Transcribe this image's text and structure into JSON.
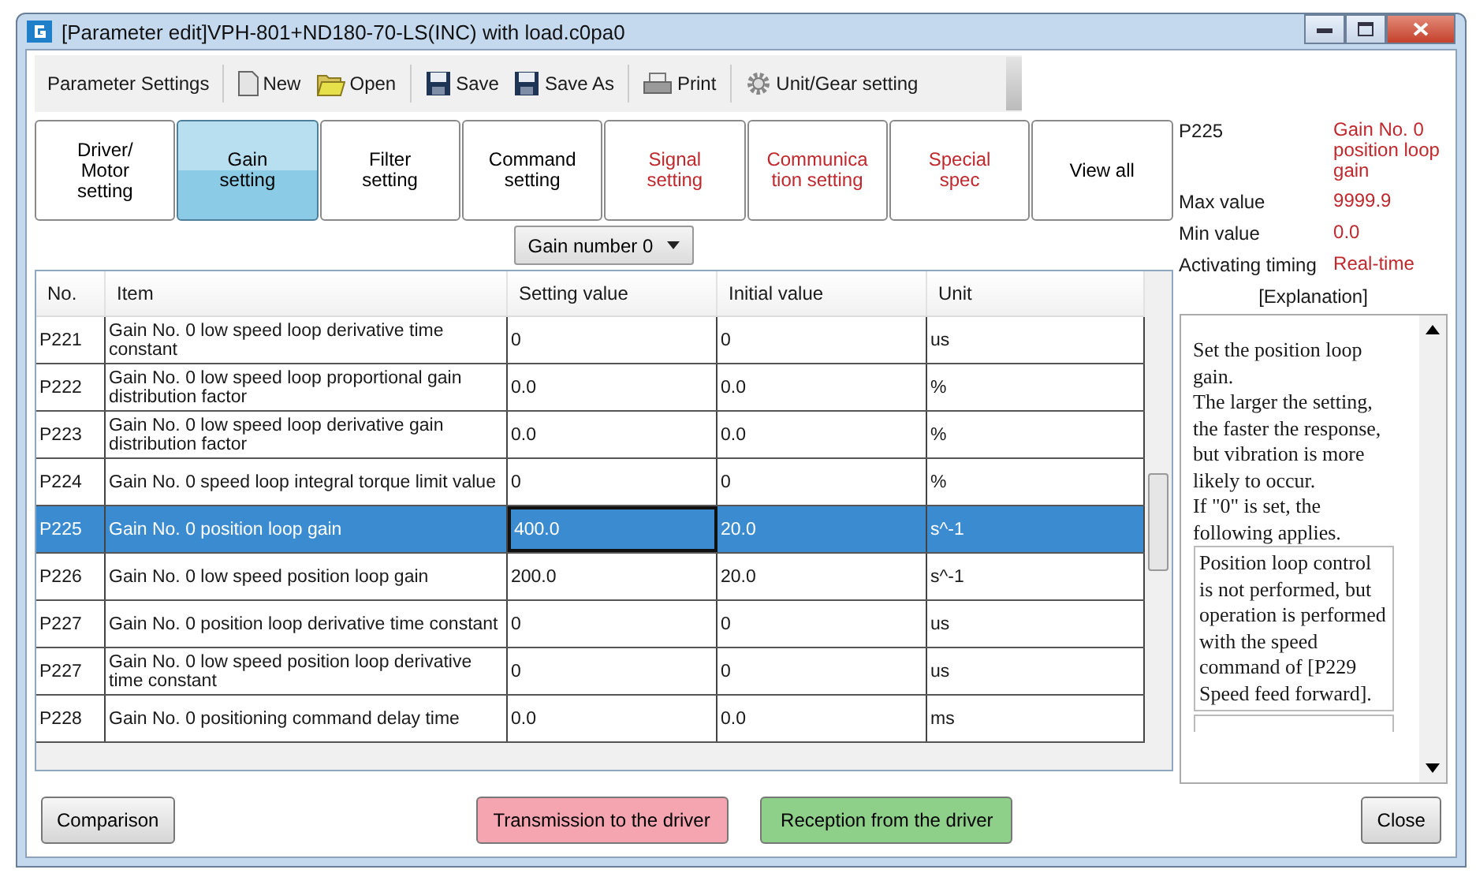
{
  "window": {
    "title": "[Parameter edit]VPH-801+ND180-70-LS(INC) with load.c0pa0"
  },
  "toolbar": {
    "label": "Parameter Settings",
    "items": [
      {
        "kind": "new",
        "label": "New"
      },
      {
        "kind": "open",
        "label": "Open"
      },
      {
        "kind": "save",
        "label": "Save"
      },
      {
        "kind": "save",
        "label": "Save As"
      },
      {
        "kind": "print",
        "label": "Print"
      },
      {
        "kind": "gear",
        "label": "Unit/Gear setting"
      }
    ]
  },
  "tabs": [
    {
      "label": "Driver/\nMotor\nsetting",
      "selected": false,
      "modified": false
    },
    {
      "label": "Gain\nsetting",
      "selected": true,
      "modified": false
    },
    {
      "label": "Filter\nsetting",
      "selected": false,
      "modified": false
    },
    {
      "label": "Command\nsetting",
      "selected": false,
      "modified": false
    },
    {
      "label": "Signal\nsetting",
      "selected": false,
      "modified": true
    },
    {
      "label": "Communica\ntion setting",
      "selected": false,
      "modified": true
    },
    {
      "label": "Special\nspec",
      "selected": false,
      "modified": true
    },
    {
      "label": "View all",
      "selected": false,
      "modified": false
    }
  ],
  "gain_dropdown": {
    "value": "Gain number 0"
  },
  "table": {
    "columns": [
      "No.",
      "Item",
      "Setting value",
      "Initial value",
      "Unit"
    ],
    "rows": [
      {
        "no": "P221",
        "item": "Gain No. 0 low speed loop derivative time constant",
        "setting": "0",
        "initial": "0",
        "unit": "us",
        "selected": false
      },
      {
        "no": "P222",
        "item": "Gain No. 0 low speed loop proportional gain distribution factor",
        "setting": "0.0",
        "initial": "0.0",
        "unit": "%",
        "selected": false
      },
      {
        "no": "P223",
        "item": "Gain No. 0 low speed loop derivative gain distribution factor",
        "setting": "0.0",
        "initial": "0.0",
        "unit": "%",
        "selected": false
      },
      {
        "no": "P224",
        "item": "Gain No. 0 speed loop integral torque limit value",
        "setting": "0",
        "initial": "0",
        "unit": "%",
        "selected": false
      },
      {
        "no": "P225",
        "item": "Gain No. 0 position loop gain",
        "setting": "400.0",
        "initial": "20.0",
        "unit": "s^-1",
        "selected": true
      },
      {
        "no": "P226",
        "item": "Gain No. 0 low speed position loop gain",
        "setting": "200.0",
        "initial": "20.0",
        "unit": "s^-1",
        "selected": false
      },
      {
        "no": "P227",
        "item": "Gain No. 0 position loop derivative time constant",
        "setting": "0",
        "initial": "0",
        "unit": "us",
        "selected": false
      },
      {
        "no": "P227",
        "item": "Gain No. 0 low speed position loop derivative time constant",
        "setting": "0",
        "initial": "0",
        "unit": "us",
        "selected": false
      },
      {
        "no": "P228",
        "item": "Gain No. 0 positioning command delay time",
        "setting": "0.0",
        "initial": "0.0",
        "unit": "ms",
        "selected": false
      }
    ]
  },
  "info": {
    "parameter": "P225",
    "name": "Gain No. 0 position loop gain",
    "fields": [
      {
        "label": "Max value",
        "value": "9999.9"
      },
      {
        "label": "Min value",
        "value": "0.0"
      },
      {
        "label": "Activating timing",
        "value": "Real-time"
      }
    ],
    "explanation_heading": "[Explanation]",
    "explanation": "Set the position loop gain.\nThe larger the setting, the faster the response, but vibration is more likely to occur.\nIf \"0\" is set, the following applies.",
    "note": "Position loop control is not performed, but operation is performed with the speed command of [P229 Speed feed forward]."
  },
  "buttons": [
    {
      "kind": "plain",
      "label": "Comparison"
    },
    {
      "kind": "send",
      "label": "Transmission to the driver"
    },
    {
      "kind": "receive",
      "label": "Reception from the driver"
    },
    {
      "kind": "plain",
      "label": "Close"
    }
  ]
}
